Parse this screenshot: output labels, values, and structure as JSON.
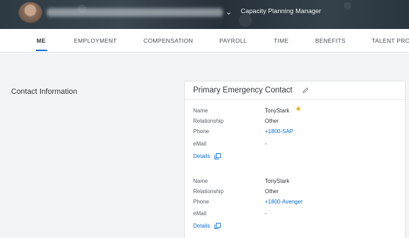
{
  "header": {
    "role_title": "Capacity Planning Manager",
    "chevron_icon": "chevron-down-icon"
  },
  "tabs": [
    {
      "label": "ME",
      "active": true
    },
    {
      "label": "EMPLOYMENT"
    },
    {
      "label": "COMPENSATION"
    },
    {
      "label": "PAYROLL"
    },
    {
      "label": "TIME"
    },
    {
      "label": "BENEFITS"
    },
    {
      "label": "TALENT PRO"
    }
  ],
  "section": {
    "title": "Contact Information"
  },
  "card": {
    "title": "Primary Emergency Contact",
    "edit_icon": "pencil-icon",
    "contacts": [
      {
        "name_label": "Name",
        "name": "TonyStark",
        "primary_icon": "star-icon",
        "relationship_label": "Relationship",
        "relationship": "Other",
        "phone_label": "Phone",
        "phone": "+1800-SAP",
        "email_label": "eMail",
        "email": "-",
        "details_label": "Details"
      },
      {
        "name_label": "Name",
        "name": "TonyStark",
        "relationship_label": "Relationship",
        "relationship": "Other",
        "phone_label": "Phone",
        "phone": "+1800-Avenger",
        "email_label": "eMail",
        "email": "-",
        "details_label": "Details"
      }
    ]
  },
  "colors": {
    "accent": "#0a6ed1",
    "star": "#e9a800",
    "header_bg": "#2d3a44"
  }
}
